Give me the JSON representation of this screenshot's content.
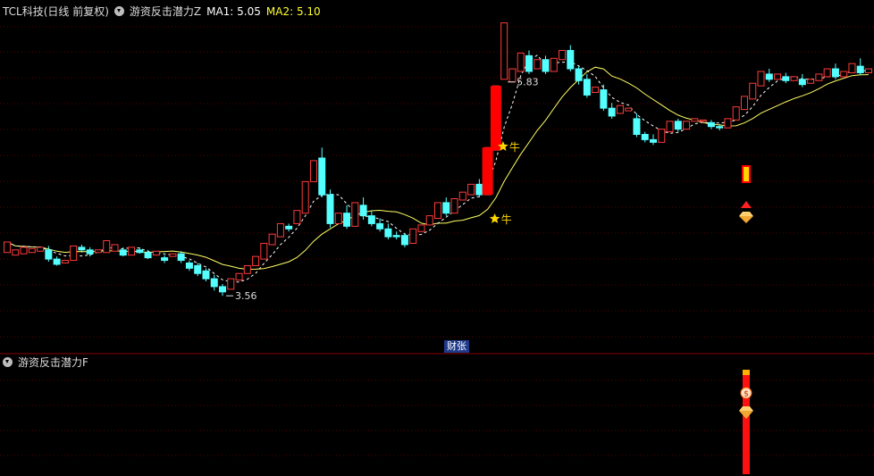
{
  "header": {
    "title": "TCL科技(日线 前复权)",
    "indicator": "游资反击潜力Z",
    "ma1_label": "MA1: 5.05",
    "ma2_label": "MA2: 5.10"
  },
  "sub_header": {
    "indicator": "游资反击潜力F"
  },
  "divider_tag": "财张",
  "colors": {
    "up": "#ff3b3b",
    "down": "#54ffff",
    "ma1": "#ffffff",
    "ma2": "#ffff66",
    "signal": "#ff0000",
    "star": "#ffd700"
  },
  "chart_data": {
    "type": "candlestick",
    "price_range": [
      3.35,
      5.95
    ],
    "annotations": {
      "high_label": "5.83",
      "low_label": "3.56",
      "signal_label": "牛"
    },
    "candles": [
      [
        4.08,
        4.16,
        4.05,
        4.08
      ],
      [
        4.06,
        4.1,
        4.03,
        4.07
      ],
      [
        4.07,
        4.12,
        4.05,
        4.09
      ],
      [
        4.08,
        4.11,
        4.05,
        4.09
      ],
      [
        4.09,
        4.12,
        4.07,
        4.11
      ],
      [
        4.1,
        4.03,
        4.13,
        4.01
      ],
      [
        4.03,
        3.99,
        4.05,
        3.98
      ],
      [
        4.0,
        4.02,
        3.97,
        4.01
      ],
      [
        4.02,
        4.13,
        4.0,
        4.11
      ],
      [
        4.12,
        4.1,
        4.14,
        4.08
      ],
      [
        4.1,
        4.07,
        4.12,
        4.05
      ],
      [
        4.08,
        4.1,
        4.06,
        4.08
      ],
      [
        4.08,
        4.17,
        4.06,
        4.09
      ],
      [
        4.09,
        4.14,
        4.07,
        4.1
      ],
      [
        4.1,
        4.06,
        4.12,
        4.05
      ],
      [
        4.06,
        4.12,
        4.05,
        4.11
      ],
      [
        4.1,
        4.08,
        4.12,
        4.07
      ],
      [
        4.08,
        4.04,
        4.1,
        4.03
      ],
      [
        4.06,
        4.09,
        4.04,
        4.07
      ],
      [
        4.04,
        4.02,
        4.06,
        4.0
      ],
      [
        4.05,
        4.07,
        4.03,
        4.06
      ],
      [
        4.07,
        4.02,
        4.09,
        4.0
      ],
      [
        4.0,
        3.96,
        4.02,
        3.94
      ],
      [
        3.98,
        3.92,
        4.0,
        3.9
      ],
      [
        3.94,
        3.88,
        3.96,
        3.86
      ],
      [
        3.88,
        3.82,
        3.91,
        3.79
      ],
      [
        3.82,
        3.78,
        3.84,
        3.75
      ],
      [
        3.8,
        3.88,
        3.78,
        3.87
      ],
      [
        3.87,
        3.92,
        3.85,
        3.91
      ],
      [
        3.92,
        3.98,
        3.9,
        3.97
      ],
      [
        3.98,
        4.05,
        3.96,
        4.04
      ],
      [
        4.03,
        4.15,
        4.01,
        4.14
      ],
      [
        4.14,
        4.22,
        4.12,
        4.2
      ],
      [
        4.2,
        4.3,
        4.18,
        4.28
      ],
      [
        4.28,
        4.26,
        4.3,
        4.24
      ],
      [
        4.3,
        4.4,
        4.28,
        4.38
      ],
      [
        4.38,
        4.62,
        4.36,
        4.6
      ],
      [
        4.62,
        4.78,
        4.58,
        4.76
      ],
      [
        4.8,
        4.52,
        4.88,
        4.5
      ],
      [
        4.52,
        4.3,
        4.56,
        4.27
      ],
      [
        4.3,
        4.38,
        4.28,
        4.36
      ],
      [
        4.38,
        4.28,
        4.44,
        4.26
      ],
      [
        4.28,
        4.46,
        4.24,
        4.44
      ],
      [
        4.44,
        4.36,
        4.5,
        4.33
      ],
      [
        4.36,
        4.3,
        4.4,
        4.28
      ],
      [
        4.3,
        4.26,
        4.34,
        4.24
      ],
      [
        4.26,
        4.2,
        4.3,
        4.18
      ],
      [
        4.21,
        4.2,
        4.24,
        4.18
      ],
      [
        4.21,
        4.14,
        4.23,
        4.12
      ],
      [
        4.15,
        4.26,
        4.14,
        4.24
      ],
      [
        4.24,
        4.29,
        4.22,
        4.28
      ],
      [
        4.29,
        4.36,
        4.26,
        4.34
      ],
      [
        4.34,
        4.46,
        4.32,
        4.44
      ],
      [
        4.46,
        4.38,
        4.5,
        4.36
      ],
      [
        4.38,
        4.49,
        4.36,
        4.48
      ],
      [
        4.48,
        4.54,
        4.46,
        4.52
      ],
      [
        4.52,
        4.6,
        4.5,
        4.58
      ],
      [
        4.6,
        4.52,
        4.64,
        4.5
      ],
      [
        4.52,
        4.88,
        4.5,
        4.86
      ],
      [
        4.86,
        5.35,
        4.84,
        5.33
      ],
      [
        5.4,
        5.83,
        5.38,
        5.65
      ],
      [
        5.38,
        5.48,
        5.32,
        5.46
      ],
      [
        5.46,
        5.6,
        5.42,
        5.58
      ],
      [
        5.58,
        5.46,
        5.62,
        5.44
      ],
      [
        5.48,
        5.55,
        5.45,
        5.52
      ],
      [
        5.55,
        5.46,
        5.58,
        5.44
      ],
      [
        5.46,
        5.56,
        5.44,
        5.54
      ],
      [
        5.55,
        5.62,
        5.52,
        5.6
      ],
      [
        5.62,
        5.48,
        5.66,
        5.46
      ],
      [
        5.48,
        5.39,
        5.5,
        5.36
      ],
      [
        5.4,
        5.28,
        5.44,
        5.26
      ],
      [
        5.3,
        5.34,
        5.26,
        5.32
      ],
      [
        5.32,
        5.18,
        5.36,
        5.16
      ],
      [
        5.18,
        5.12,
        5.22,
        5.1
      ],
      [
        5.14,
        5.2,
        5.12,
        5.18
      ],
      [
        5.16,
        5.18,
        5.14,
        5.17
      ],
      [
        5.1,
        4.98,
        5.14,
        4.96
      ],
      [
        4.98,
        4.94,
        5.0,
        4.92
      ],
      [
        4.94,
        4.92,
        4.98,
        4.9
      ],
      [
        4.92,
        5.02,
        4.91,
        5.0
      ],
      [
        5.0,
        5.08,
        4.98,
        5.06
      ],
      [
        5.08,
        5.02,
        5.1,
        5.0
      ],
      [
        5.02,
        5.08,
        5.0,
        5.06
      ],
      [
        5.08,
        5.1,
        5.06,
        5.08
      ],
      [
        5.08,
        5.09,
        5.05,
        5.07
      ],
      [
        5.07,
        5.04,
        5.09,
        5.02
      ],
      [
        5.04,
        5.03,
        5.06,
        5.01
      ],
      [
        5.03,
        5.1,
        5.02,
        5.09
      ],
      [
        5.09,
        5.19,
        5.07,
        5.17
      ],
      [
        5.17,
        5.27,
        5.15,
        5.25
      ],
      [
        5.25,
        5.37,
        5.23,
        5.35
      ],
      [
        5.35,
        5.46,
        5.33,
        5.44
      ],
      [
        5.44,
        5.4,
        5.48,
        5.38
      ],
      [
        5.4,
        5.44,
        5.38,
        5.42
      ],
      [
        5.42,
        5.39,
        5.45,
        5.37
      ],
      [
        5.39,
        5.42,
        5.37,
        5.4
      ],
      [
        5.4,
        5.36,
        5.44,
        5.34
      ],
      [
        5.37,
        5.4,
        5.34,
        5.39
      ],
      [
        5.39,
        5.44,
        5.37,
        5.42
      ],
      [
        5.42,
        5.48,
        5.4,
        5.46
      ],
      [
        5.48,
        5.42,
        5.52,
        5.4
      ],
      [
        5.42,
        5.46,
        5.4,
        5.45
      ],
      [
        5.45,
        5.52,
        5.43,
        5.5
      ],
      [
        5.5,
        5.45,
        5.56,
        5.43
      ],
      [
        5.45,
        5.48,
        5.43,
        5.47
      ]
    ]
  }
}
